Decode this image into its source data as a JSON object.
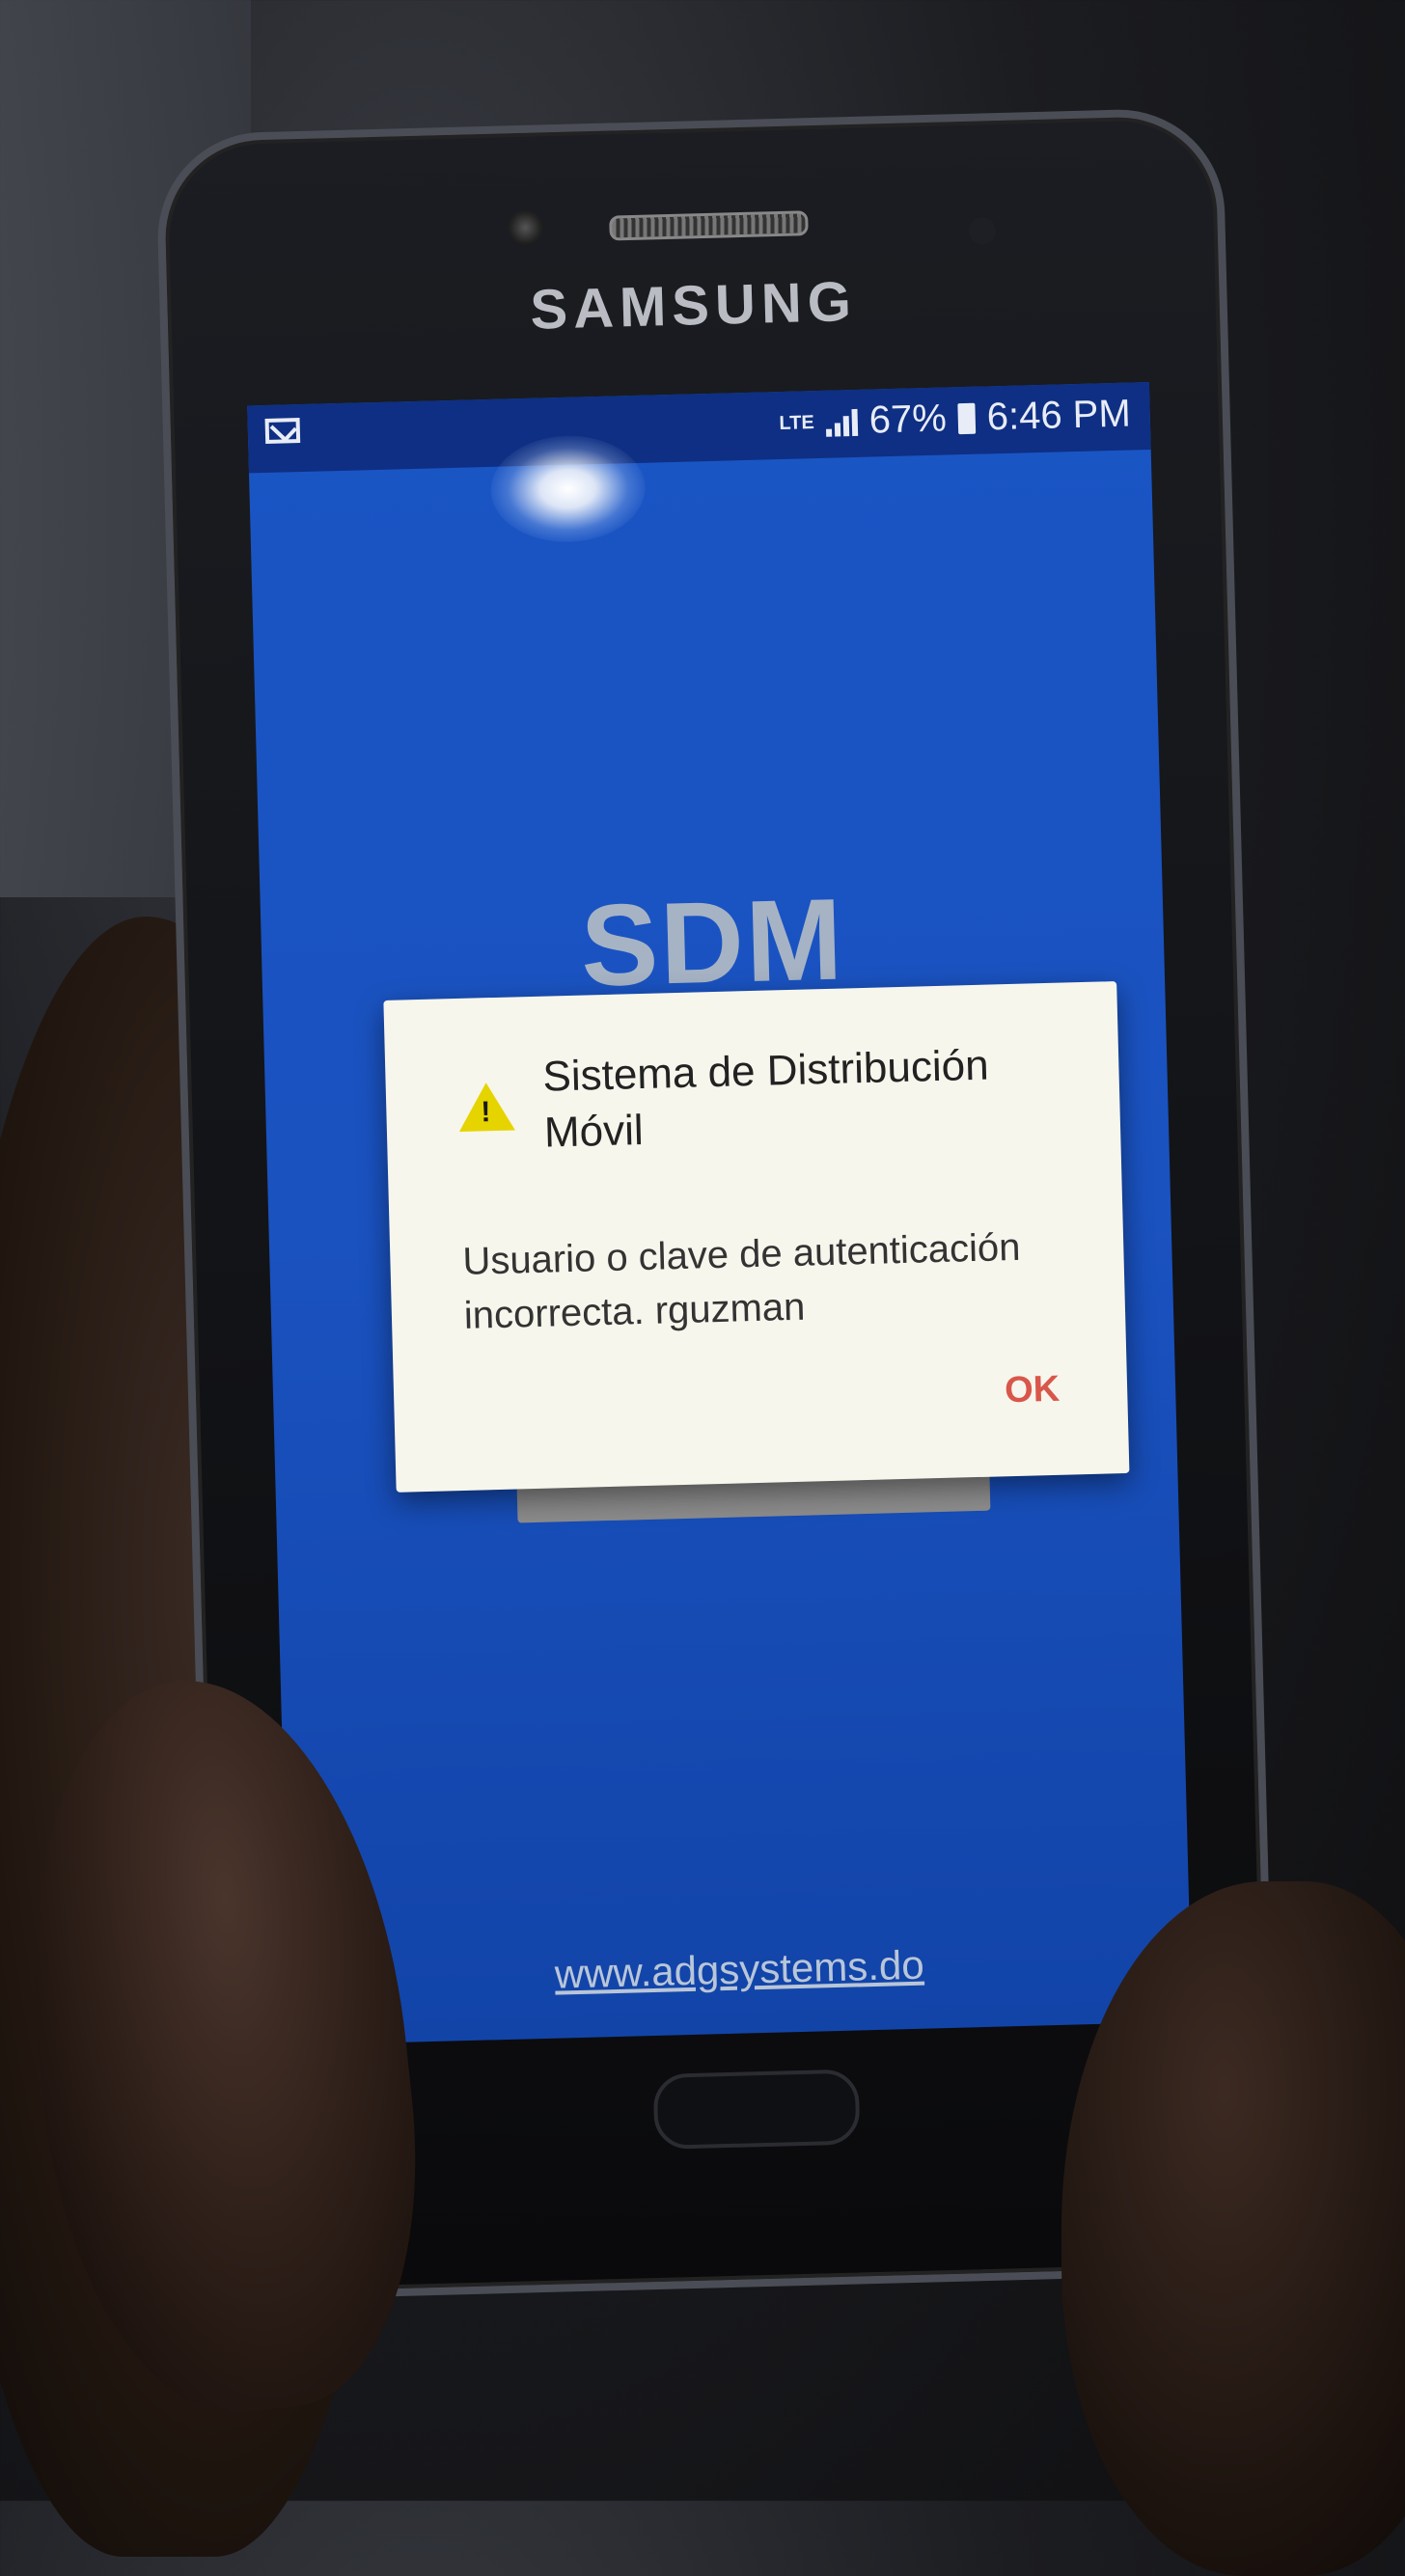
{
  "phone": {
    "brand": "SAMSUNG"
  },
  "status_bar": {
    "mail_icon": "mail-icon",
    "network": "LTE",
    "battery_percent": "67%",
    "time": "6:46 PM"
  },
  "app": {
    "title": "SDM",
    "website": "www.adgsystems.do"
  },
  "dialog": {
    "icon": "warning-icon",
    "title": "Sistema de Distribución Móvil",
    "message": "Usuario o clave de autenticación incorrecta. rguzman",
    "ok_label": "OK",
    "ok_color": "#d9564a",
    "warning_color": "#e6d400"
  },
  "colors": {
    "screen_blue": "#1a52c0",
    "status_bar": "#0e2f83"
  }
}
